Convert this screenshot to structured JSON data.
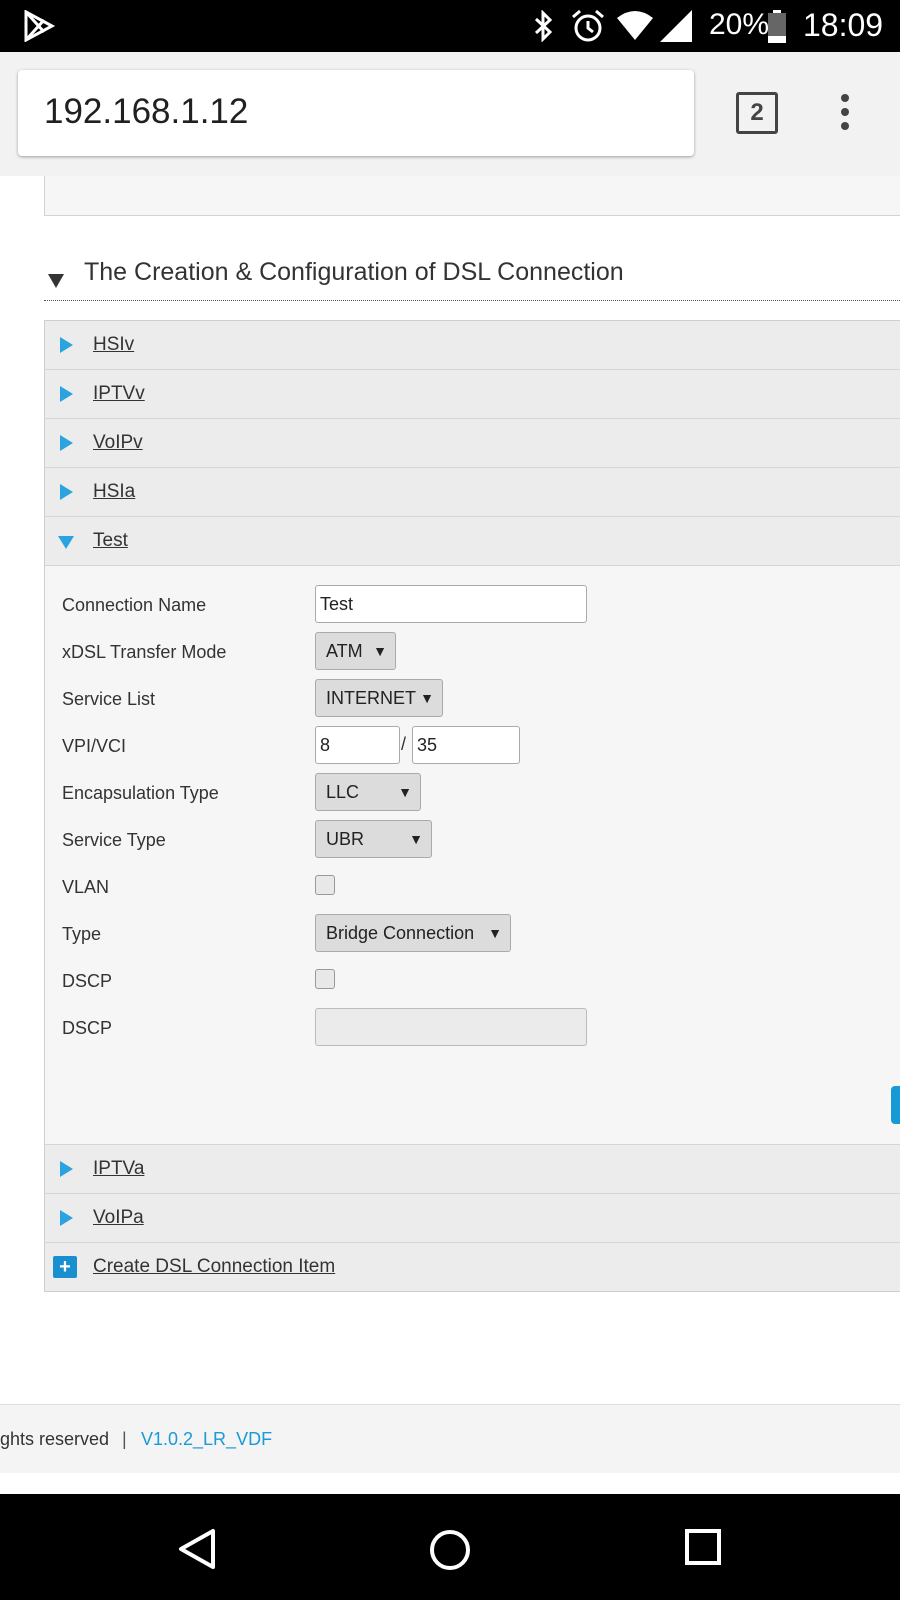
{
  "status_bar": {
    "battery": "20%",
    "time": "18:09"
  },
  "browser": {
    "url": "192.168.1.12",
    "tab_count": "2"
  },
  "section": {
    "title": "The Creation & Configuration of DSL Connection"
  },
  "accordion": {
    "items": [
      {
        "label": "HSIv"
      },
      {
        "label": "IPTVv"
      },
      {
        "label": "VoIPv"
      },
      {
        "label": "HSIa"
      },
      {
        "label": "Test"
      },
      {
        "label": "IPTVa"
      },
      {
        "label": "VoIPa"
      }
    ],
    "create_label": "Create DSL Connection Item"
  },
  "form": {
    "connection_name": {
      "label": "Connection Name",
      "value": "Test"
    },
    "xdsl_mode": {
      "label": "xDSL Transfer Mode",
      "value": "ATM"
    },
    "service_list": {
      "label": "Service List",
      "value": "INTERNET"
    },
    "vpi_vci": {
      "label": "VPI/VCI",
      "vpi": "8",
      "separator": "/",
      "vci": "35"
    },
    "encapsulation": {
      "label": "Encapsulation Type",
      "value": "LLC"
    },
    "service_type": {
      "label": "Service Type",
      "value": "UBR"
    },
    "vlan": {
      "label": "VLAN",
      "checked": false
    },
    "type": {
      "label": "Type",
      "value": "Bridge Connection"
    },
    "dscp_check": {
      "label": "DSCP",
      "checked": false
    },
    "dscp_value": {
      "label": "DSCP",
      "value": ""
    }
  },
  "footer": {
    "copyright": "ghts reserved",
    "separator": "|",
    "version": "V1.0.2_LR_VDF"
  },
  "colors": {
    "accent": "#2aa3de",
    "link": "#1a9ad7"
  }
}
